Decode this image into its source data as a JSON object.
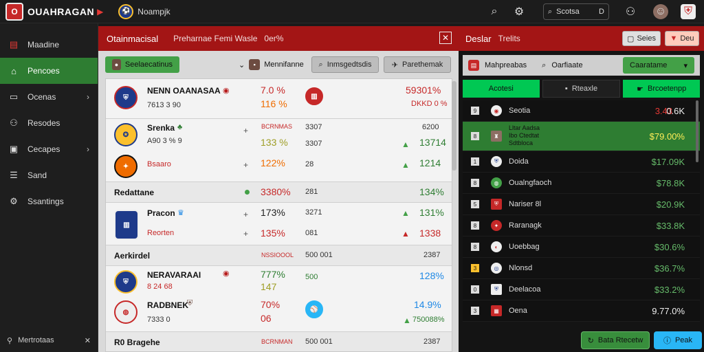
{
  "topbar": {
    "logo_text": "O",
    "brand": "OUAHRAGAN",
    "brand_arrow": "▶",
    "context_label": "Noampjk",
    "search_label": "Scotsa",
    "search_suffix": "D",
    "icons": [
      "search-icon",
      "gear-icon",
      "user-icon",
      "avatar-icon",
      "flag-icon"
    ]
  },
  "sidebar": {
    "items": [
      {
        "label": "Maadine",
        "icon": "flag-icon",
        "chevron": false,
        "active": false
      },
      {
        "label": "Pencoes",
        "icon": "home-icon",
        "chevron": false,
        "active": true
      },
      {
        "label": "Ocenas",
        "icon": "card-icon",
        "chevron": true,
        "active": false
      },
      {
        "label": "Resodes",
        "icon": "people-icon",
        "chevron": false,
        "active": false
      },
      {
        "label": "Cecapes",
        "icon": "wallet-icon",
        "chevron": true,
        "active": false
      },
      {
        "label": "Sand",
        "icon": "list-icon",
        "chevron": false,
        "active": false
      },
      {
        "label": "Ssantings",
        "icon": "settings-icon",
        "chevron": false,
        "active": false
      }
    ],
    "footer_label": "Mertrotaas"
  },
  "main": {
    "title": "Otainmacisal",
    "subtitle": "Preharnae Femi Wasle",
    "subtitle_pct": "0er%",
    "toolbar": {
      "primary": "Seelaecatinus",
      "dropdown": "Mennifanne",
      "button2": "Inmsgedtsdis",
      "button3": "Parethemak"
    },
    "rows": [
      {
        "name": "NENN OAANASAA",
        "sub": "7613 3 90",
        "val1": "7.0 %",
        "val2": "116 %",
        "right1": "59301%",
        "right2": "DKKD 0 %"
      },
      {
        "name": "Srenka",
        "sub": "A90 3 % 9",
        "mid_label": "BCRNMAS",
        "val1": "133 %",
        "col2": "3307",
        "right": "13714",
        "right_top": "6200"
      },
      {
        "name": "Bsaaro",
        "val1": "122%",
        "col2": "28",
        "right": "1214"
      }
    ],
    "section1": {
      "label": "Redattane",
      "val": "3380%",
      "col2": "281",
      "right": "134%"
    },
    "rows2": [
      {
        "name": "Pracon",
        "val": "173%",
        "col2": "3271",
        "right": "131%"
      },
      {
        "name": "Reorten",
        "val": "135%",
        "col2": "081",
        "right": "1338"
      }
    ],
    "section2": {
      "label": "Aerkirdel",
      "mid": "NSSIOOOL",
      "col2": "500 001",
      "right": "2387"
    },
    "rows3": [
      {
        "name": "NERAVARAAI",
        "sub": "8 24 68",
        "val1": "777%",
        "val2": "147",
        "col2": "500",
        "right": "128%"
      },
      {
        "name": "RADBNEK",
        "sub": "7333 0",
        "val1": "70%",
        "val2": "06",
        "right": "14.9%",
        "right_sub": "750088%"
      }
    ],
    "section3": {
      "label": "R0 Bragehe",
      "mid": "BCRNMAN",
      "col2": "500 001",
      "right": "2387"
    }
  },
  "right": {
    "title": "Deslar",
    "subtitle": "Trelits",
    "btn1": "Seies",
    "btn2": "Deu",
    "filter_label": "Mahpreabas",
    "filter_label2": "Oarfiaate",
    "filter_btn": "Caaratame",
    "tabs": [
      "Acotesi",
      "Rteaxle",
      "Brcoetenpp"
    ],
    "rows": [
      {
        "num": "9",
        "name": "Seotia",
        "odds": "3.43",
        "odds2": "0.6K",
        "odds_color": "#e53935"
      },
      {
        "num": "8",
        "name": "Lltar Aadsa",
        "sub": "Ibo Ctedtat",
        "sub2": "Sdtbloca",
        "odds": "$79.00%",
        "odds_color": "#ffee58",
        "hl": true
      },
      {
        "num": "1",
        "name": "Doida",
        "odds": "$17.09K",
        "odds_color": "#66bb6a"
      },
      {
        "num": "8",
        "name": "Oualngfaoch",
        "odds": "$78.8K",
        "odds_color": "#66bb6a"
      },
      {
        "num": "5",
        "name": "Nariser 8l",
        "odds": "$20.9K",
        "odds_color": "#66bb6a"
      },
      {
        "num": "8",
        "name": "Raranagk",
        "odds": "$33.8K",
        "odds_color": "#66bb6a"
      },
      {
        "num": "8",
        "name": "Uoebbag",
        "odds": "$30.6%",
        "odds_color": "#66bb6a"
      },
      {
        "num": "3",
        "name": "Nlonsd",
        "odds": "$36.7%",
        "odds_color": "#66bb6a"
      },
      {
        "num": "0",
        "name": "Deelacoa",
        "odds": "$33.2%",
        "odds_color": "#66bb6a"
      },
      {
        "num": "3",
        "name": "Oena",
        "odds": "9.77.0%",
        "odds_color": "#eeeeee"
      }
    ],
    "footer_btn1": "Bata Rtecetw",
    "footer_btn2": "Peak"
  },
  "colors": {
    "accent_red": "#a31515",
    "accent_green": "#2e7d32",
    "button_blue": "#29b6f6"
  }
}
